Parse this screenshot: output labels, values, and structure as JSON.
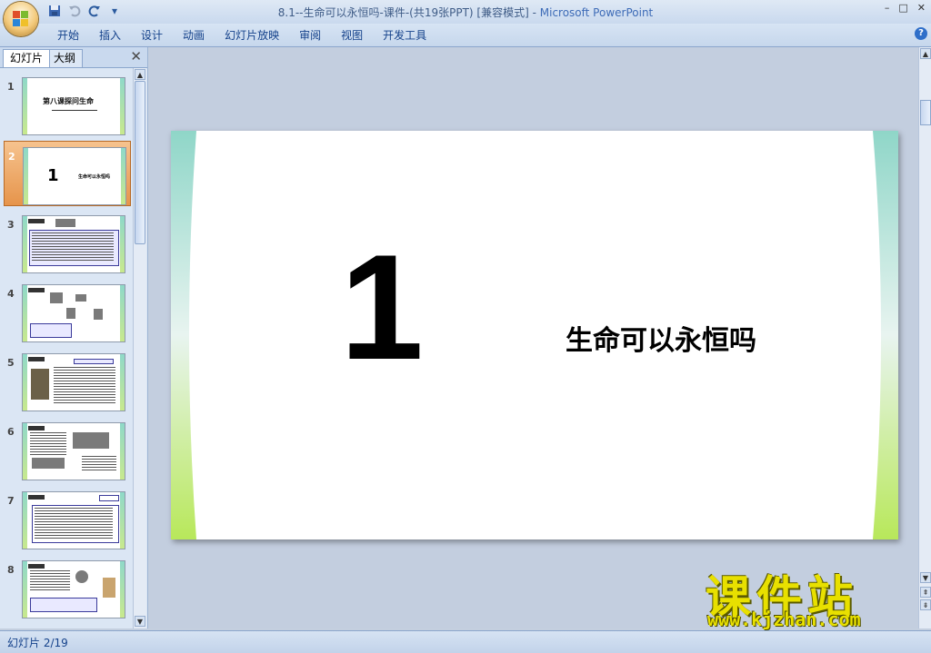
{
  "window": {
    "title": "8.1--生命可以永恒吗-课件-(共19张PPT) [兼容模式]",
    "separator": " - ",
    "app_name": "Microsoft PowerPoint",
    "minimize": "–",
    "restore": "□",
    "close": "✕"
  },
  "quick_access": {
    "save_icon": "save-icon",
    "undo_icon": "undo-icon",
    "redo_icon": "redo-icon",
    "customize": "▾"
  },
  "ribbon": {
    "tabs": [
      "开始",
      "插入",
      "设计",
      "动画",
      "幻灯片放映",
      "审阅",
      "视图",
      "开发工具"
    ],
    "help": "?"
  },
  "left_pane": {
    "tabs": {
      "slides": "幻灯片",
      "outline": "大纲"
    },
    "close": "✕",
    "slides": [
      {
        "num": "1",
        "title": "第八课探问生命"
      },
      {
        "num": "2",
        "number": "1",
        "subtitle": "生命可以永恒吗"
      },
      {
        "num": "3"
      },
      {
        "num": "4"
      },
      {
        "num": "5"
      },
      {
        "num": "6"
      },
      {
        "num": "7"
      },
      {
        "num": "8"
      }
    ],
    "scroll_up": "▲",
    "scroll_down": "▼"
  },
  "slide": {
    "number": "1",
    "title": "生命可以永恒吗"
  },
  "main_scroll": {
    "up": "▲",
    "down": "▼",
    "prev": "⇞",
    "next": "⇟"
  },
  "watermark": {
    "cn": "课件站",
    "url": "www.kjzhan.com"
  },
  "status": {
    "slide_counter": "幻灯片 2/19"
  },
  "colors": {
    "accent": "#15428b",
    "selected": "#e6944b",
    "slide_border_top": "#8fd9c9",
    "slide_border_bottom": "#b8e85a"
  }
}
